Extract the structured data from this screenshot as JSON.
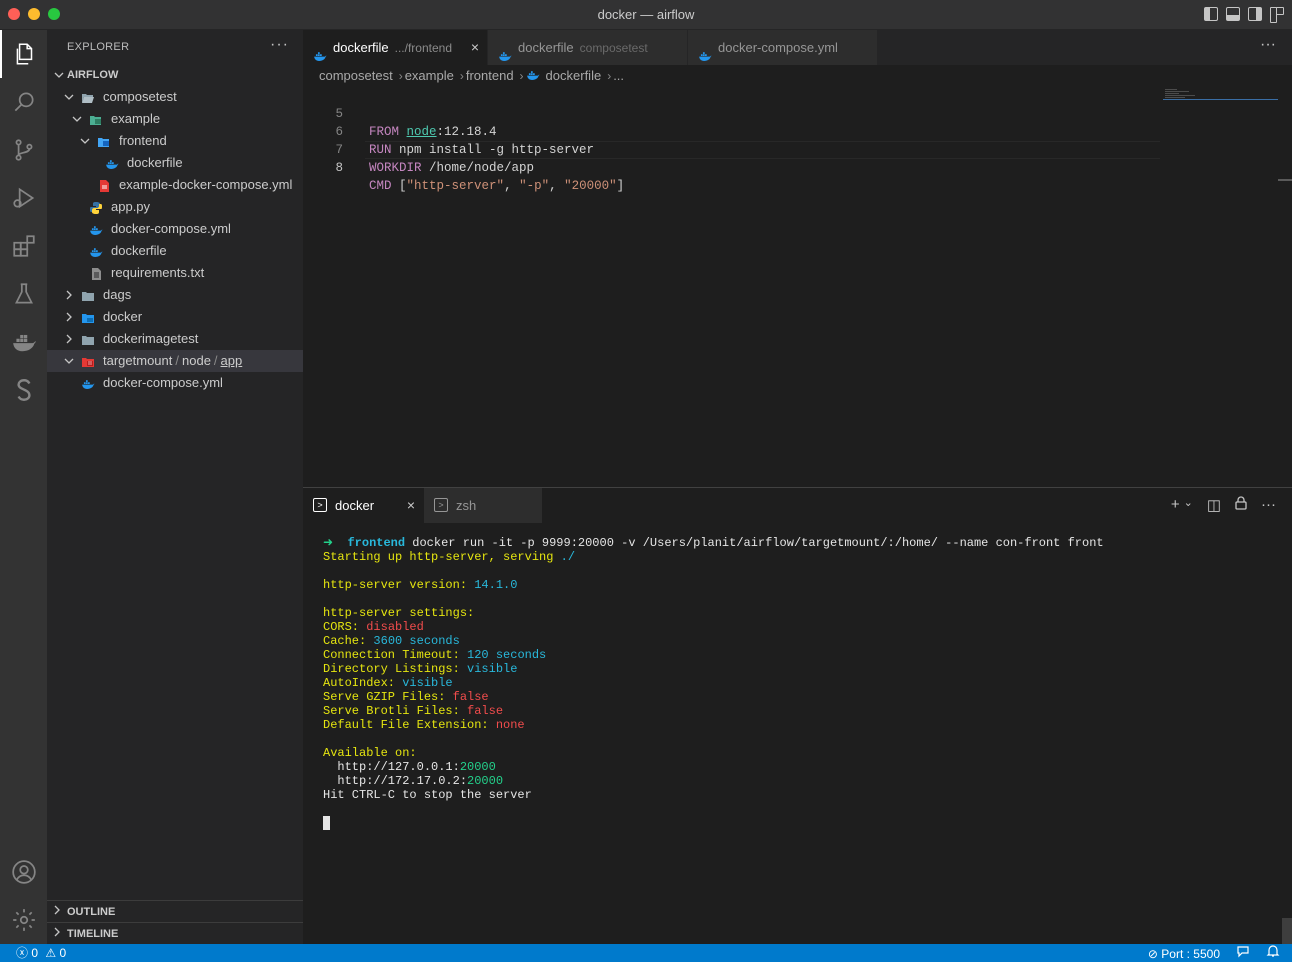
{
  "window": {
    "title": "docker — airflow"
  },
  "sidebar": {
    "title": "EXPLORER",
    "more": "···",
    "root": "AIRFLOW",
    "tree": [
      {
        "label": "composetest"
      },
      {
        "label": "example"
      },
      {
        "label": "frontend"
      },
      {
        "label": "dockerfile"
      },
      {
        "label": "example-docker-compose.yml"
      },
      {
        "label": "app.py"
      },
      {
        "label": "docker-compose.yml"
      },
      {
        "label": "dockerfile"
      },
      {
        "label": "requirements.txt"
      },
      {
        "label": "dags"
      },
      {
        "label": "docker"
      },
      {
        "label": "dockerimagetest"
      },
      {
        "label_parts": [
          "targetmount",
          "/",
          "node",
          "/",
          "app"
        ]
      },
      {
        "label": "docker-compose.yml"
      }
    ],
    "sections": {
      "outline": "OUTLINE",
      "timeline": "TIMELINE"
    }
  },
  "tabs": [
    {
      "name": "dockerfile",
      "desc": ".../frontend",
      "close": "×"
    },
    {
      "name": "dockerfile",
      "desc": "composetest"
    },
    {
      "name": "docker-compose.yml"
    }
  ],
  "tabs_more": "···",
  "breadcrumb": [
    "composetest",
    "example",
    "frontend",
    "dockerfile",
    "..."
  ],
  "editor": {
    "lines": [
      {
        "num": "5",
        "kw": "FROM",
        "node": "node",
        "rest": ":12.18.4"
      },
      {
        "num": "6",
        "kw": "RUN",
        "rest": " npm install -g http-server"
      },
      {
        "num": "7",
        "kw": "WORKDIR",
        "rest": " /home/node/app"
      },
      {
        "num": "8",
        "kw": "CMD",
        "bracket_open": " [",
        "s1": "\"http-server\"",
        "comma1": ", ",
        "s2": "\"-p\"",
        "comma2": ", ",
        "s3": "\"20000\"",
        "bracket_close": "]"
      }
    ]
  },
  "panel": {
    "tabs": [
      {
        "name": "docker",
        "icon": ">",
        "close": "×"
      },
      {
        "name": "zsh",
        "icon": ">"
      }
    ],
    "actions": {
      "add": "+",
      "chevron": "⌄",
      "split": "◫",
      "lock": "🔒",
      "more": "···"
    },
    "terminal": {
      "prompt_arrow": "➜",
      "prompt_dir": "frontend",
      "command": " docker run -it -p 9999:20000 -v /Users/planit/airflow/targetmount/:/home/ --name con-front front",
      "starting": "Starting up http-server, serving ",
      "serving_path": "./",
      "version_label": "http-server version: ",
      "version": "14.1.0",
      "settings_label": "http-server settings:",
      "settings": [
        {
          "key": "CORS: ",
          "value": "disabled",
          "color": "red"
        },
        {
          "key": "Cache: ",
          "value": "3600 seconds",
          "color": "cyan"
        },
        {
          "key": "Connection Timeout: ",
          "value": "120 seconds",
          "color": "cyan"
        },
        {
          "key": "Directory Listings: ",
          "value": "visible",
          "color": "cyan"
        },
        {
          "key": "AutoIndex: ",
          "value": "visible",
          "color": "cyan"
        },
        {
          "key": "Serve GZIP Files: ",
          "value": "false",
          "color": "red"
        },
        {
          "key": "Serve Brotli Files: ",
          "value": "false",
          "color": "red"
        },
        {
          "key": "Default File Extension: ",
          "value": "none",
          "color": "red"
        }
      ],
      "available": "Available on:",
      "urls": [
        {
          "host": "  http://127.0.0.1:",
          "port": "20000"
        },
        {
          "host": "  http://172.17.0.2:",
          "port": "20000"
        }
      ],
      "hint": "Hit CTRL-C to stop the server"
    }
  },
  "statusbar": {
    "errors": "0",
    "warnings": "0",
    "port": "Port : 5500"
  },
  "colors": {
    "accent": "#007acc",
    "activity_bar": "#333333",
    "sidebar": "#252526",
    "editor": "#1e1e1e",
    "docker_blue": "#2496ed",
    "terminal_yellow": "#e5e510",
    "terminal_cyan": "#29b8db",
    "terminal_red": "#f14c4c",
    "terminal_green": "#23d18b"
  },
  "icons": [
    "files-icon",
    "search-icon",
    "source-control-icon",
    "run-debug-icon",
    "extensions-icon",
    "testing-icon",
    "docker-icon",
    "s-icon",
    "account-icon",
    "settings-gear-icon"
  ]
}
